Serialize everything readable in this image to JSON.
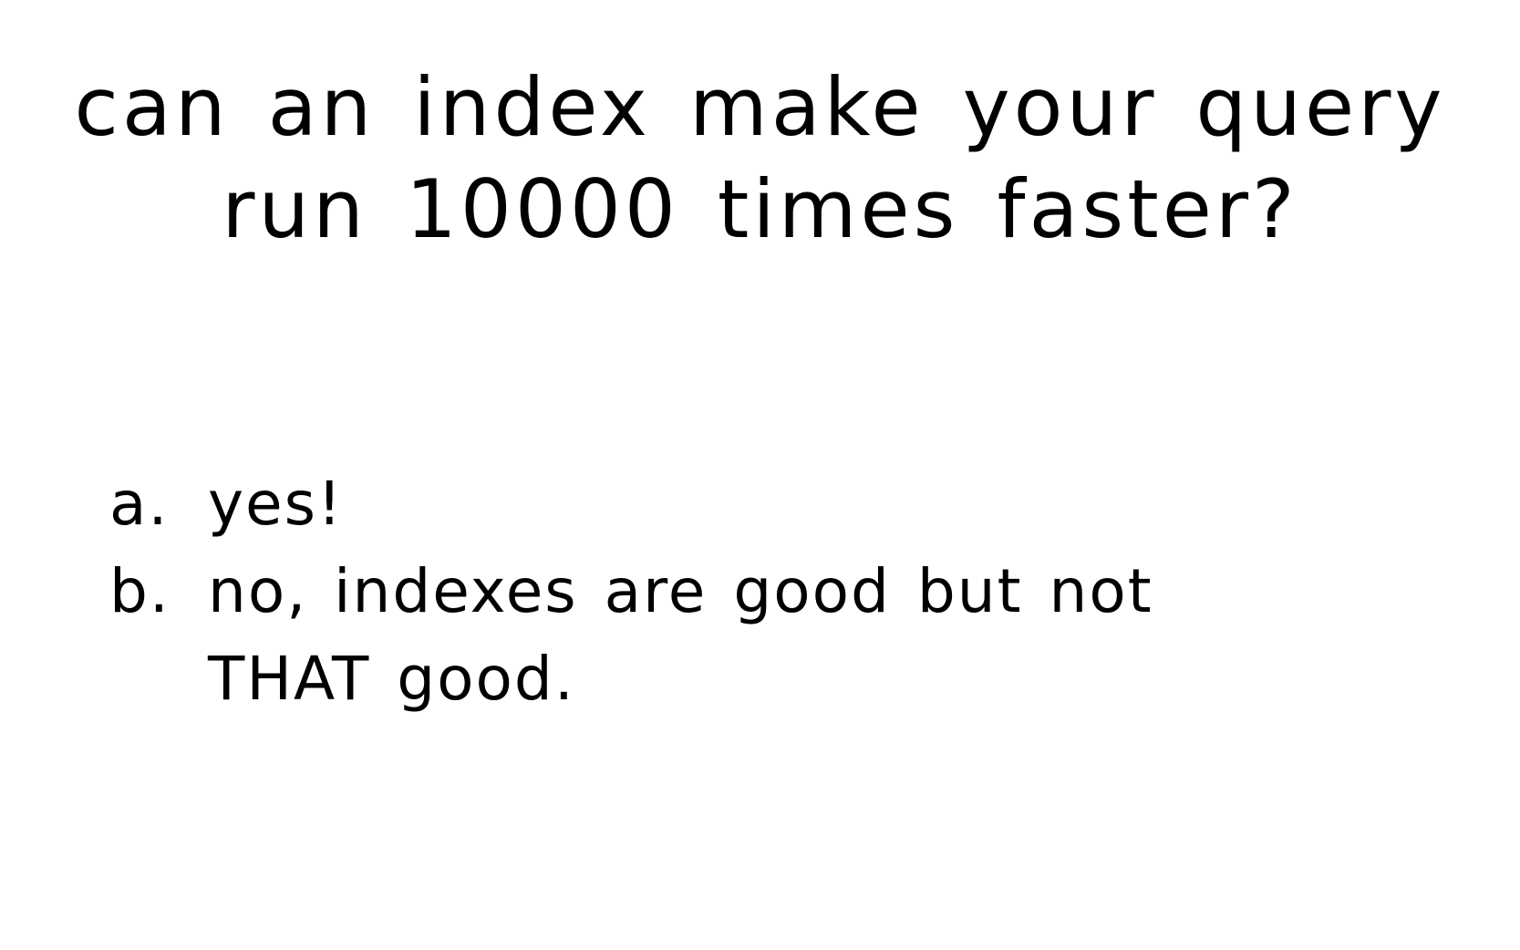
{
  "question": {
    "line1": "can an index make your query",
    "line2": "run 10000 times faster?"
  },
  "answers": [
    {
      "marker": "a.",
      "line1": "yes!",
      "line2": ""
    },
    {
      "marker": "b.",
      "line1": "no, indexes are good but not",
      "line2": "THAT good."
    }
  ]
}
